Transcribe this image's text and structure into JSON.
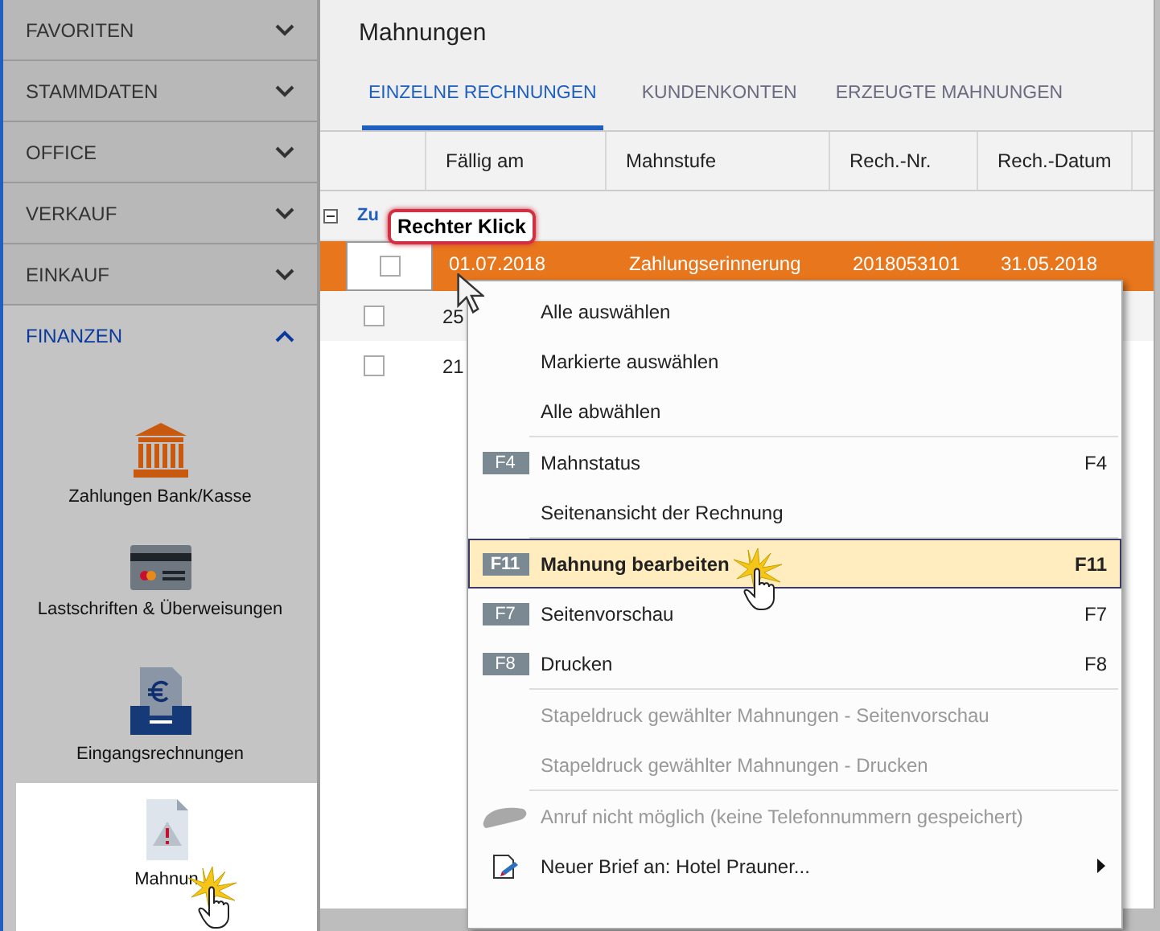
{
  "sidebar": {
    "sections": [
      {
        "label": "FAVORITEN",
        "expanded": false
      },
      {
        "label": "STAMMDATEN",
        "expanded": false
      },
      {
        "label": "OFFICE",
        "expanded": false
      },
      {
        "label": "VERKAUF",
        "expanded": false
      },
      {
        "label": "EINKAUF",
        "expanded": false
      },
      {
        "label": "FINANZEN",
        "expanded": true
      }
    ],
    "apps": [
      {
        "label": "Zahlungen Bank/Kasse",
        "kind": "bank",
        "selected": false
      },
      {
        "label": "Lastschriften & Überweisungen",
        "kind": "card",
        "selected": false
      },
      {
        "label": "Eingangsrechnungen",
        "kind": "inbox",
        "selected": false
      },
      {
        "label": "Mahnun",
        "kind": "warning",
        "selected": true
      }
    ]
  },
  "window": {
    "title": "Mahnungen"
  },
  "tabs": [
    {
      "label": "EINZELNE RECHNUNGEN",
      "selected": true
    },
    {
      "label": "KUNDENKONTEN",
      "selected": false
    },
    {
      "label": "ERZEUGTE MAHNUNGEN",
      "selected": false
    }
  ],
  "table": {
    "columns": [
      "Fällig am",
      "Mahnstufe",
      "Rech.-Nr.",
      "Rech.-Datum"
    ],
    "group": {
      "label": "Zu",
      "expanded": true
    },
    "rows": [
      {
        "checked": false,
        "selected": true,
        "cells": [
          "01.07.2018",
          "Zahlungserinnerung",
          "2018053101",
          "31.05.2018"
        ]
      },
      {
        "checked": false,
        "selected": false,
        "cells": [
          "25"
        ]
      },
      {
        "checked": false,
        "selected": false,
        "cells": [
          "21"
        ]
      }
    ]
  },
  "callout": "Rechter Klick",
  "context_menu": [
    {
      "kind": "item",
      "label": "Alle auswählen"
    },
    {
      "kind": "item",
      "label": "Markierte auswählen"
    },
    {
      "kind": "item",
      "label": "Alle abwählen"
    },
    {
      "kind": "separator"
    },
    {
      "kind": "item",
      "label": "Mahnstatus",
      "key": "F4",
      "shortcut": "F4"
    },
    {
      "kind": "item",
      "label": "Seitenansicht der Rechnung"
    },
    {
      "kind": "separator"
    },
    {
      "kind": "item",
      "label": "Mahnung bearbeiten",
      "key": "F11",
      "shortcut": "F11",
      "selected": true
    },
    {
      "kind": "item",
      "label": "Seitenvorschau",
      "key": "F7",
      "shortcut": "F7"
    },
    {
      "kind": "item",
      "label": "Drucken",
      "key": "F8",
      "shortcut": "F8"
    },
    {
      "kind": "separator"
    },
    {
      "kind": "item",
      "label": "Stapeldruck gewählter Mahnungen - Seitenvorschau",
      "disabled": true
    },
    {
      "kind": "item",
      "label": "Stapeldruck gewählter Mahnungen - Drucken",
      "disabled": true
    },
    {
      "kind": "separator"
    },
    {
      "kind": "phone-item",
      "label": "Anruf nicht möglich (keine Telefonnummern gespeichert)",
      "disabled": true
    },
    {
      "kind": "letter-item",
      "label": "Neuer Brief an: Hotel Prauner...",
      "submenu": true
    }
  ]
}
